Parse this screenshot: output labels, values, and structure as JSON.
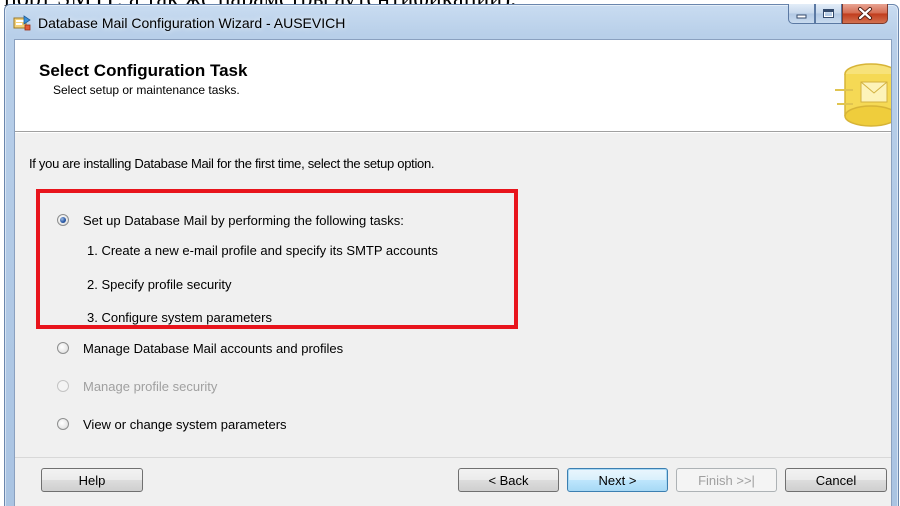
{
  "document": {
    "cropped_text": "порт SMTP, а так же параметры аутентификации)."
  },
  "window": {
    "title": "Database Mail Configuration Wizard - AUSEVICH",
    "controls": {
      "minimize": "minimize-icon",
      "maximize": "maximize-icon",
      "close": "close-icon"
    }
  },
  "header": {
    "title": "Select Configuration Task",
    "subtitle": "Select setup or maintenance tasks."
  },
  "intro_text": "If you are installing Database Mail for the first time, select the setup option.",
  "options": [
    {
      "label": "Set up Database Mail by performing the following tasks:",
      "checked": true,
      "enabled": true
    },
    {
      "label": "Manage Database Mail accounts and profiles",
      "checked": false,
      "enabled": true
    },
    {
      "label": "Manage profile security",
      "checked": false,
      "enabled": false
    },
    {
      "label": "View or change system parameters",
      "checked": false,
      "enabled": true
    }
  ],
  "setup_tasks": [
    "1. Create a new e-mail profile and specify its SMTP accounts",
    "2. Specify profile security",
    "3. Configure system parameters"
  ],
  "buttons": {
    "help": "Help",
    "back": "< Back",
    "next": "Next >",
    "finish": "Finish >>|",
    "cancel": "Cancel"
  },
  "colors": {
    "highlight_box": "#e8141c",
    "selected_radio": "#2a5aa8",
    "disabled_text": "#a0a0a0"
  }
}
